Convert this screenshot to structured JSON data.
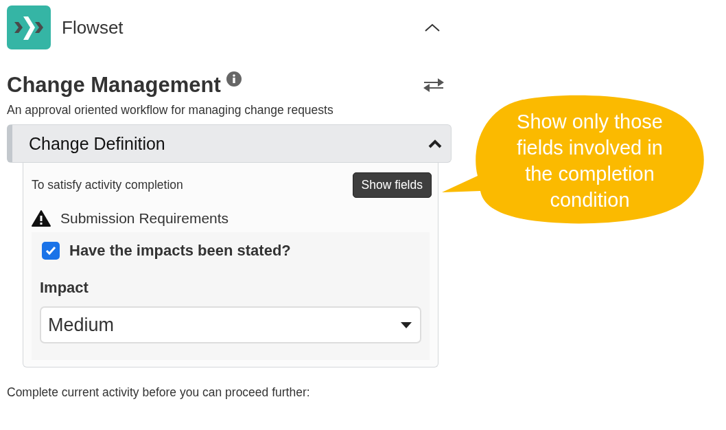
{
  "app": {
    "name": "Flowset",
    "expanded": true
  },
  "workflow": {
    "title": "Change Management",
    "description": "An approval oriented workflow for managing change requests"
  },
  "section": {
    "title": "Change Definition",
    "expanded": true,
    "completion_label": "To satisfy activity completion",
    "show_fields_button": "Show fields",
    "requirements_title": "Submission Requirements",
    "checkbox": {
      "label": "Have the impacts been stated?",
      "checked": true
    },
    "select": {
      "label": "Impact",
      "value": "Medium"
    }
  },
  "footer": "Complete current activity before you can proceed further:",
  "callout": {
    "text": "Show only those fields involved in the completion condition"
  }
}
